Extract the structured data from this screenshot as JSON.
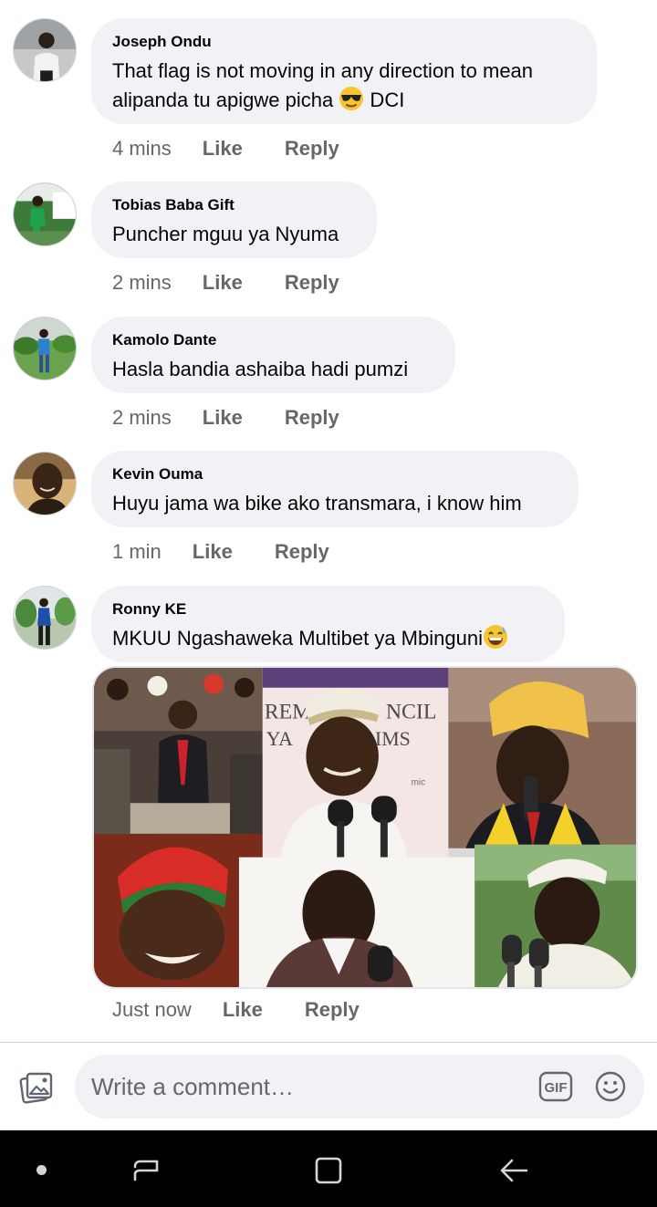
{
  "comments": [
    {
      "author": "Joseph Ondu",
      "line1": "That flag is not moving in any direction to mean",
      "line2": "alipanda tu apigwe picha",
      "emoji": "sunglasses-emoji",
      "line2_suffix": " DCI",
      "time": "4 mins",
      "like": "Like",
      "reply": "Reply"
    },
    {
      "author": "Tobias Baba Gift",
      "text": "Puncher mguu ya Nyuma",
      "time": "2 mins",
      "like": "Like",
      "reply": "Reply"
    },
    {
      "author": "Kamolo Dante",
      "text": "Hasla bandia ashaiba hadi pumzi",
      "time": "2 mins",
      "like": "Like",
      "reply": "Reply"
    },
    {
      "author": "Kevin Ouma",
      "text": "Huyu jama wa bike ako transmara, i know him",
      "time": "1 min",
      "like": "Like",
      "reply": "Reply"
    },
    {
      "author": "Ronny KE",
      "text": "MKUU Ngashaweka Multibet ya Mbinguni",
      "emoji": "grinning-sweat-emoji",
      "time": "Just now",
      "like": "Like",
      "reply": "Reply",
      "photo_sign_text": [
        "REM",
        "NCIL",
        "YA",
        "IMS",
        "mic"
      ]
    }
  ],
  "composer": {
    "placeholder": "Write a comment…",
    "gif_label": "GIF"
  },
  "icons": {
    "gallery": "photo-gallery-icon",
    "gif": "gif-icon",
    "emoji": "smiley-icon",
    "nav_dot": "nav-dot-icon",
    "recents": "recent-apps-icon",
    "home": "home-icon",
    "back": "back-icon"
  },
  "colors": {
    "bubble": "#f0f2f5",
    "meta_text": "#65676b",
    "text": "#050505",
    "navbar": "#000000"
  }
}
